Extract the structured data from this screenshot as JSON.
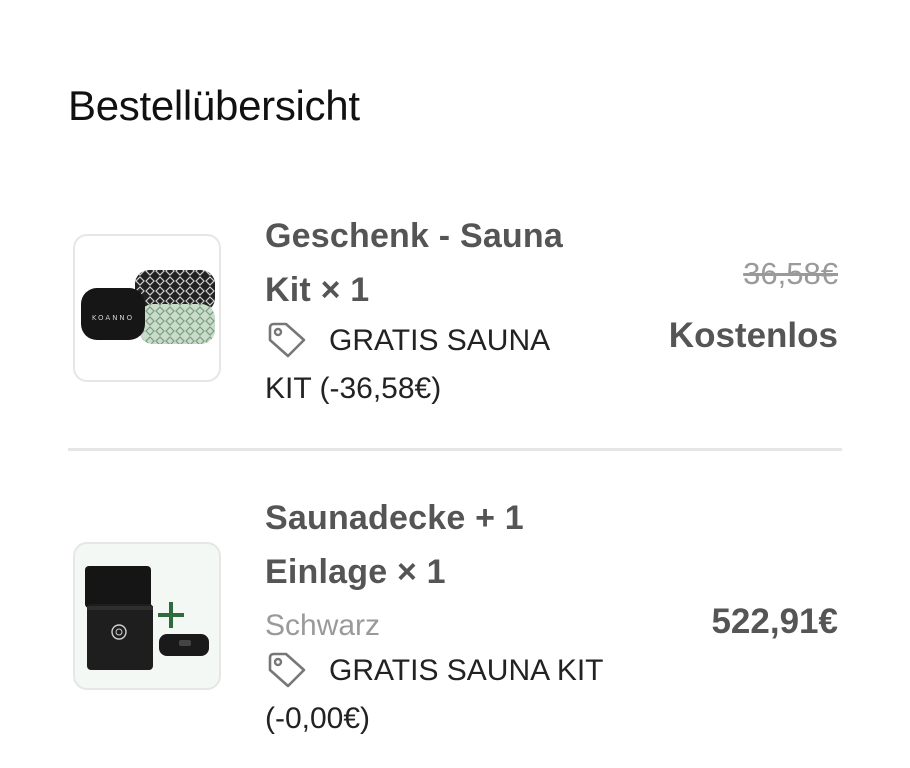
{
  "header": {
    "title": "Bestellübersicht"
  },
  "items": [
    {
      "title_line1": "Geschenk - Sauna",
      "title_line2": "Kit × 1",
      "discount_line1": "GRATIS SAUNA",
      "discount_line2": "KIT (-36,58€)",
      "original_price": "36,58€",
      "price": "Kostenlos",
      "brand_mark": "KOANNO",
      "icon": "tag-icon"
    },
    {
      "title_line1": "Saunadecke + 1",
      "title_line2": "Einlage × 1",
      "variant": "Schwarz",
      "discount_line1": "GRATIS SAUNA KIT",
      "discount_line2": "(-0,00€)",
      "price": "522,91€",
      "icon": "tag-icon"
    }
  ],
  "colors": {
    "title_text": "#555555",
    "muted_text": "#9a9a9a",
    "divider": "#e6e6e6",
    "product_green": "#c8dcc9",
    "product_dark": "#1c1c1c"
  }
}
